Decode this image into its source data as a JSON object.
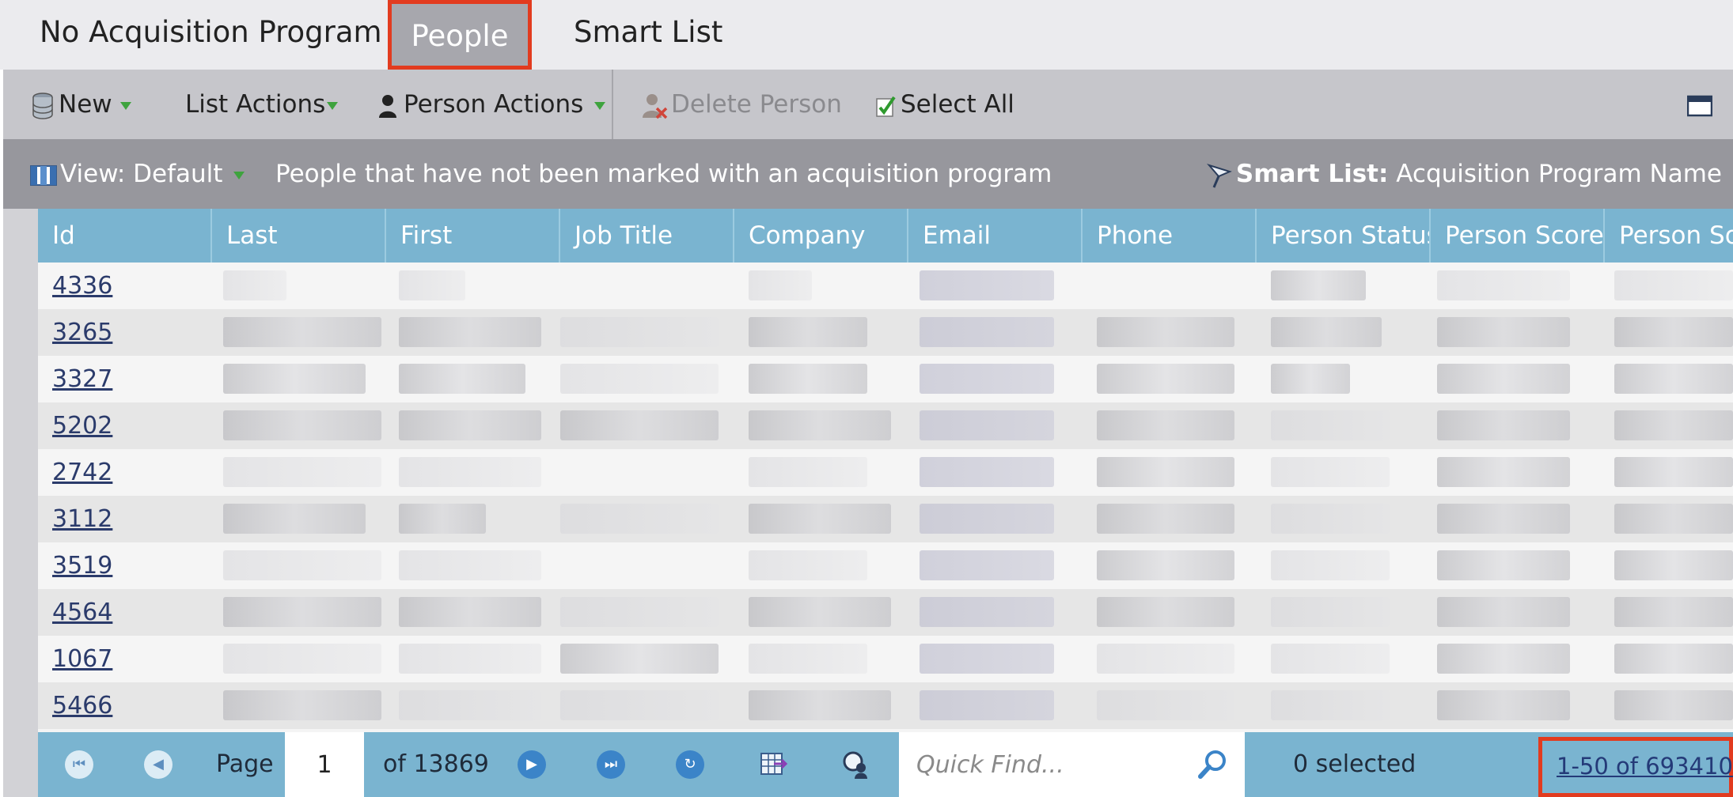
{
  "tabs": [
    {
      "label": "No Acquisition Program",
      "active": false
    },
    {
      "label": "People",
      "active": true
    },
    {
      "label": "Smart List",
      "active": false
    }
  ],
  "toolbar": {
    "new": "New",
    "list_actions": "List Actions",
    "person_actions": "Person Actions",
    "delete_person": "Delete Person",
    "select_all": "Select All"
  },
  "viewbar": {
    "view": "View: Default",
    "description": "People that have not been marked with an acquisition program",
    "smart_list_label": "Smart List:",
    "smart_list_value": "Acquisition Program Name"
  },
  "grid": {
    "columns": [
      "Id",
      "Last",
      "First",
      "Job Title",
      "Company",
      "Email",
      "Phone",
      "Person Status",
      "Person Score",
      "Person So"
    ],
    "rows": [
      {
        "id": "4336"
      },
      {
        "id": "3265"
      },
      {
        "id": "3327"
      },
      {
        "id": "5202"
      },
      {
        "id": "2742"
      },
      {
        "id": "3112"
      },
      {
        "id": "3519"
      },
      {
        "id": "4564"
      },
      {
        "id": "1067"
      },
      {
        "id": "5466"
      }
    ]
  },
  "pager": {
    "page_label": "Page",
    "page_value": "1",
    "of_pages": "of 13869",
    "quick_find_placeholder": "Quick Find...",
    "selected": "0 selected",
    "range": "1-50 of 693410"
  },
  "colors": {
    "header_blue": "#7ab4d0",
    "highlight_red": "#e23b1f",
    "active_tab": "#a7a7ad"
  }
}
